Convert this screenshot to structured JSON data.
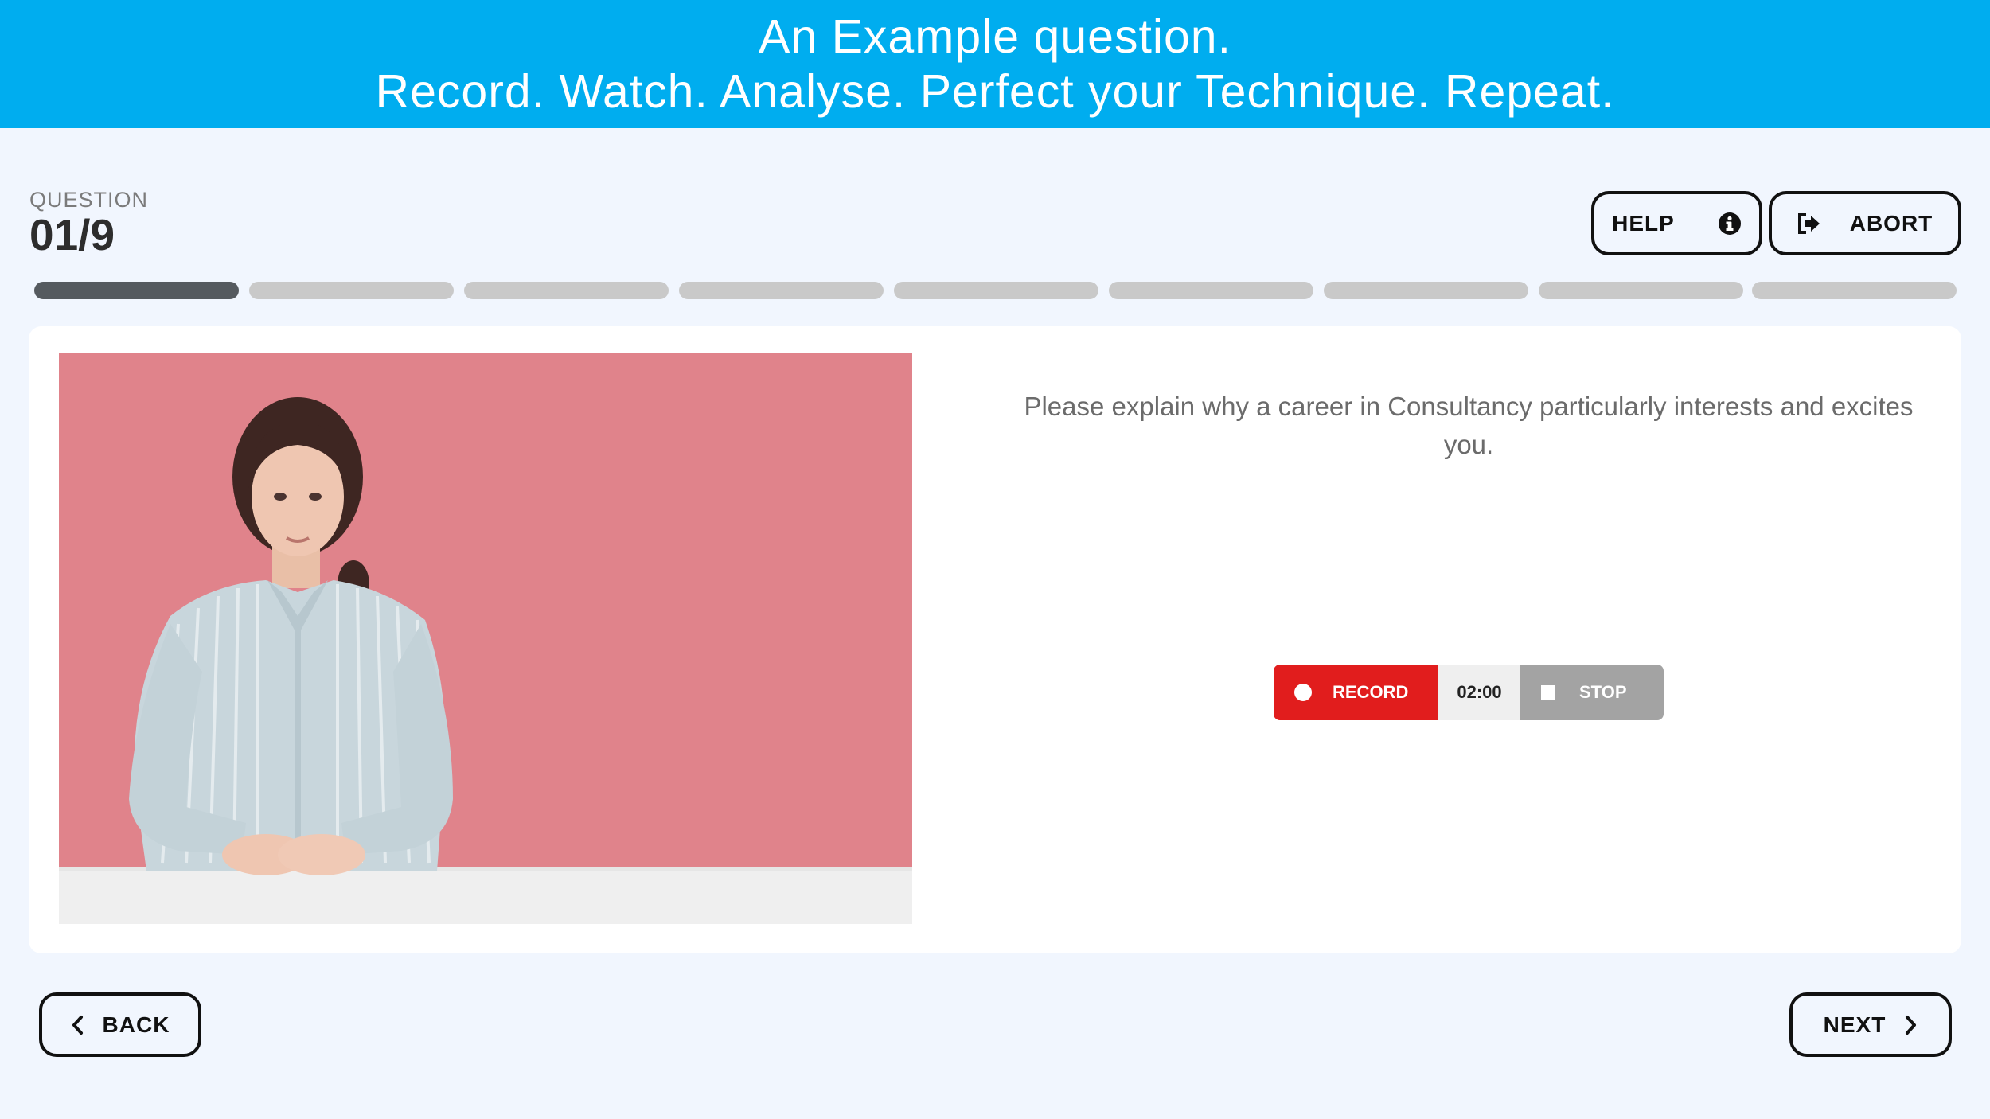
{
  "banner": {
    "line1": "An Example question.",
    "line2": "Record. Watch. Analyse. Perfect your Technique. Repeat.",
    "color": "#00adef"
  },
  "question": {
    "label": "QUESTION",
    "counter": "01/9",
    "current": 1,
    "total": 9,
    "text": "Please explain why a career in Consultancy particularly interests and excites you."
  },
  "header_buttons": {
    "help_label": "HELP",
    "help_icon": "info-circle-icon",
    "abort_label": "ABORT",
    "abort_icon": "sign-out-icon"
  },
  "recorder": {
    "record_label": "RECORD",
    "timer": "02:00",
    "stop_label": "STOP",
    "record_color": "#e11d1d",
    "stop_color": "#a3a3a3"
  },
  "nav": {
    "back_label": "BACK",
    "next_label": "NEXT"
  }
}
